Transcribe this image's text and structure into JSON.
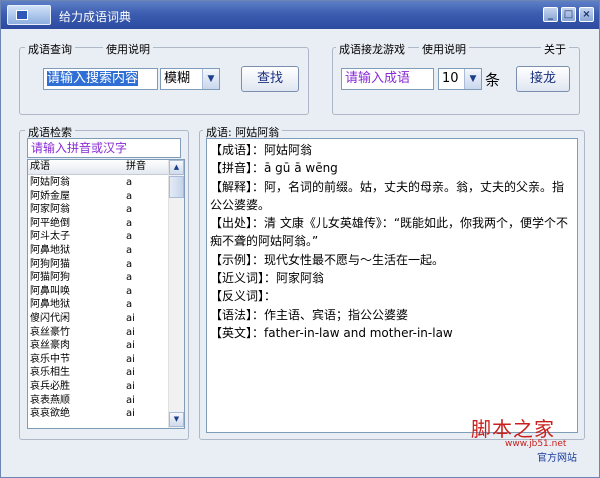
{
  "window": {
    "title": "给力成语词典"
  },
  "search": {
    "group_label": "成语查询",
    "help_label": "使用说明",
    "input_value": "请输入搜索内容",
    "mode_value": "模糊",
    "button_label": "查找"
  },
  "game": {
    "group_label": "成语接龙游戏",
    "help_label": "使用说明",
    "about_label": "关于",
    "input_value": "请输入成语",
    "count_value": "10",
    "unit": "条",
    "button_label": "接龙"
  },
  "index": {
    "group_label": "成语检索",
    "filter_placeholder": "请输入拼音或汉字",
    "col_idiom": "成语",
    "col_pinyin": "拼音",
    "rows": [
      {
        "idiom": "阿姑阿翁",
        "pinyin": "a"
      },
      {
        "idiom": "阿娇金屋",
        "pinyin": "a"
      },
      {
        "idiom": "阿家阿翁",
        "pinyin": "a"
      },
      {
        "idiom": "阿平绝倒",
        "pinyin": "a"
      },
      {
        "idiom": "阿斗太子",
        "pinyin": "a"
      },
      {
        "idiom": "阿鼻地狱",
        "pinyin": "a"
      },
      {
        "idiom": "阿狗阿猫",
        "pinyin": "a"
      },
      {
        "idiom": "阿猫阿狗",
        "pinyin": "a"
      },
      {
        "idiom": "阿鼻叫唤",
        "pinyin": "a"
      },
      {
        "idiom": "阿鼻地狱",
        "pinyin": "a"
      },
      {
        "idiom": "傻闪代闲",
        "pinyin": "ai"
      },
      {
        "idiom": "哀丝豪竹",
        "pinyin": "ai"
      },
      {
        "idiom": "哀丝豪肉",
        "pinyin": "ai"
      },
      {
        "idiom": "哀乐中节",
        "pinyin": "ai"
      },
      {
        "idiom": "哀乐相生",
        "pinyin": "ai"
      },
      {
        "idiom": "哀兵必胜",
        "pinyin": "ai"
      },
      {
        "idiom": "哀表燕顺",
        "pinyin": "ai"
      },
      {
        "idiom": "哀哀欲绝",
        "pinyin": "ai"
      }
    ]
  },
  "detail": {
    "group_label": "成语: 阿姑阿翁",
    "lines": [
      "【成语】：阿姑阿翁",
      "【拼音】：ā gū ā wēng",
      "【解释】：阿，名词的前缀。姑，丈夫的母亲。翁，丈夫的父亲。指公公婆婆。",
      "【出处】：清 文康《儿女英雄传》：“既能如此，你我两个，便学个不痴不聋的阿姑阿翁。”",
      "【示例】：现代女性最不愿与～生活在一起。",
      "【近义词】：阿家阿翁",
      "【反义词】：",
      "【语法】：作主语、宾语；指公公婆婆",
      "【英文】：father-in-law and mother-in-law"
    ]
  },
  "watermark": {
    "logo": "脚本之家",
    "url": "www.jb51.net"
  },
  "footer": {
    "site_link": "官方网站"
  }
}
